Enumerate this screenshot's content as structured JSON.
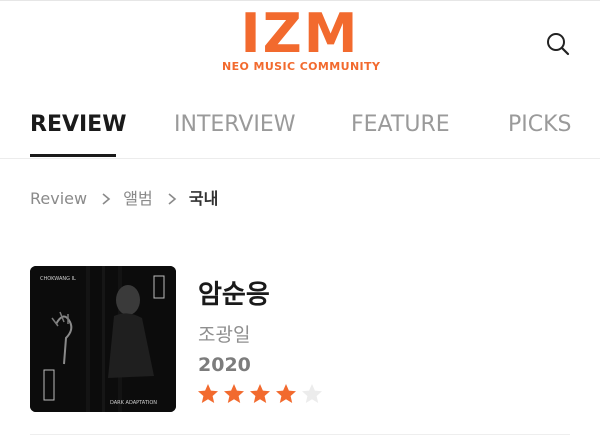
{
  "header": {
    "logo_text": "IZM",
    "logo_sub": "NEO MUSIC COMMUNITY",
    "search_icon": "search-icon"
  },
  "nav": {
    "tabs": [
      {
        "label": "REVIEW",
        "active": true
      },
      {
        "label": "INTERVIEW",
        "active": false
      },
      {
        "label": "FEATURE",
        "active": false
      },
      {
        "label": "PICKS",
        "active": false
      }
    ]
  },
  "breadcrumb": {
    "items": [
      "Review",
      "앨범",
      "국내"
    ],
    "separator_icon": "chevron-right-icon"
  },
  "album": {
    "title": "암순응",
    "artist": "조광일",
    "year": "2020",
    "rating": 4,
    "rating_max": 5,
    "cover": {
      "artist_text": "CHOKWANG IL",
      "caption": "DARK ADAPTATION"
    }
  },
  "colors": {
    "brand": "#f26a2e",
    "star_filled": "#f26a2e",
    "star_empty": "#ececec",
    "text_primary": "#1a1a1a",
    "text_muted": "#8f8f8f"
  }
}
